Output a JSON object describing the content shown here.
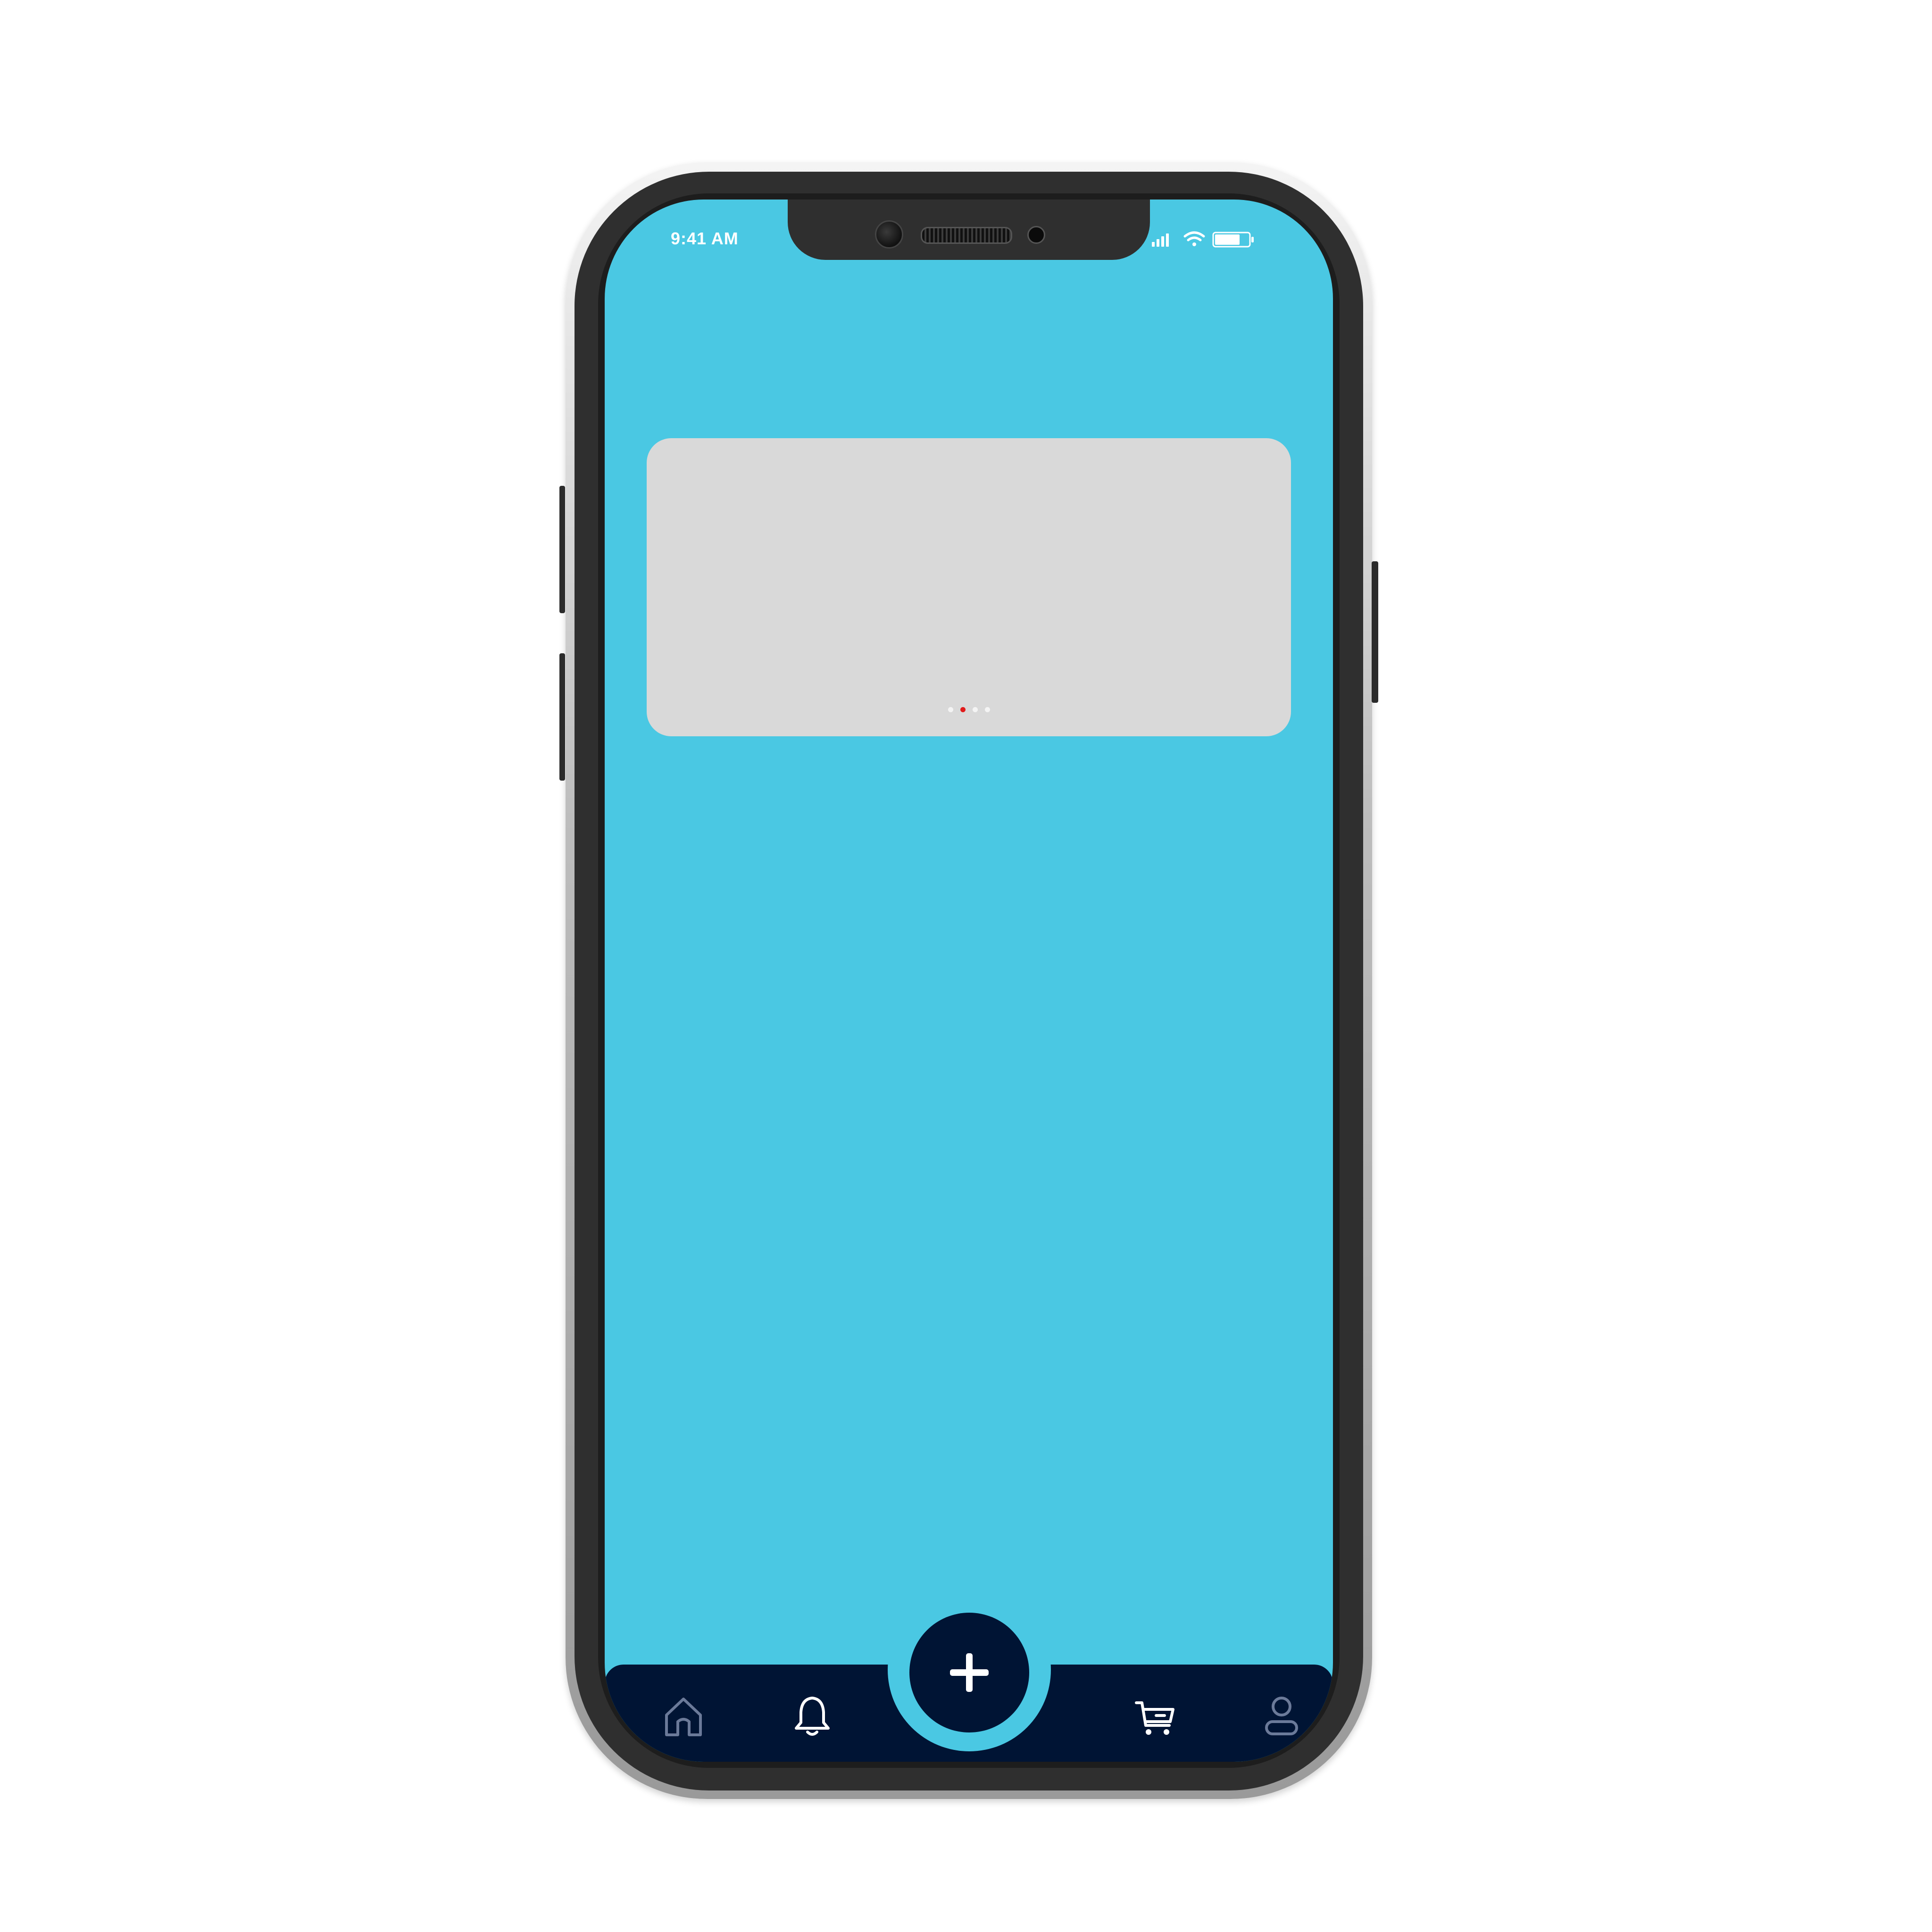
{
  "status_bar": {
    "time": "9:41 AM",
    "icons": [
      "signal-icon",
      "wifi-icon",
      "battery-icon"
    ]
  },
  "carousel": {
    "slide_count": 4,
    "active_index": 1
  },
  "fab": {
    "icon": "plus-icon"
  },
  "bottom_nav": {
    "items": [
      {
        "icon": "home-icon"
      },
      {
        "icon": "bell-icon"
      },
      {
        "icon": "cart-icon"
      },
      {
        "icon": "profile-icon"
      }
    ]
  },
  "colors": {
    "screen_background": "#4ac8e3",
    "card_background": "#d9d9d9",
    "navbar_background": "#001434",
    "active_dot": "#e11b1b",
    "inactive_dot": "#f4f4f4"
  }
}
